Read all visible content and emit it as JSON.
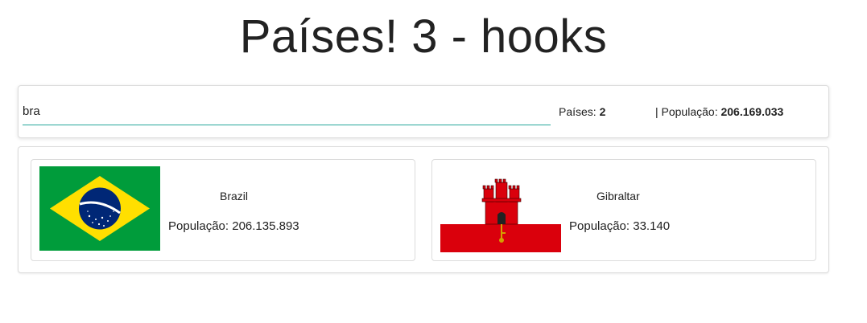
{
  "header": {
    "title": "Países! 3 - hooks"
  },
  "search": {
    "value": "bra",
    "countries_label": "Países:",
    "countries_count": "2",
    "population_label": "| População:",
    "population_total": "206.169.033"
  },
  "countries": [
    {
      "name": "Brazil",
      "population_label": "População:",
      "population": "206.135.893",
      "flag_icon": "brazil-flag-icon"
    },
    {
      "name": "Gibraltar",
      "population_label": "População:",
      "population": "33.140",
      "flag_icon": "gibraltar-flag-icon"
    }
  ],
  "colors": {
    "accent": "#26a69a",
    "brazil_green": "#009c3b",
    "brazil_yellow": "#ffdf00",
    "brazil_blue": "#002776",
    "gibraltar_red": "#da000c"
  }
}
